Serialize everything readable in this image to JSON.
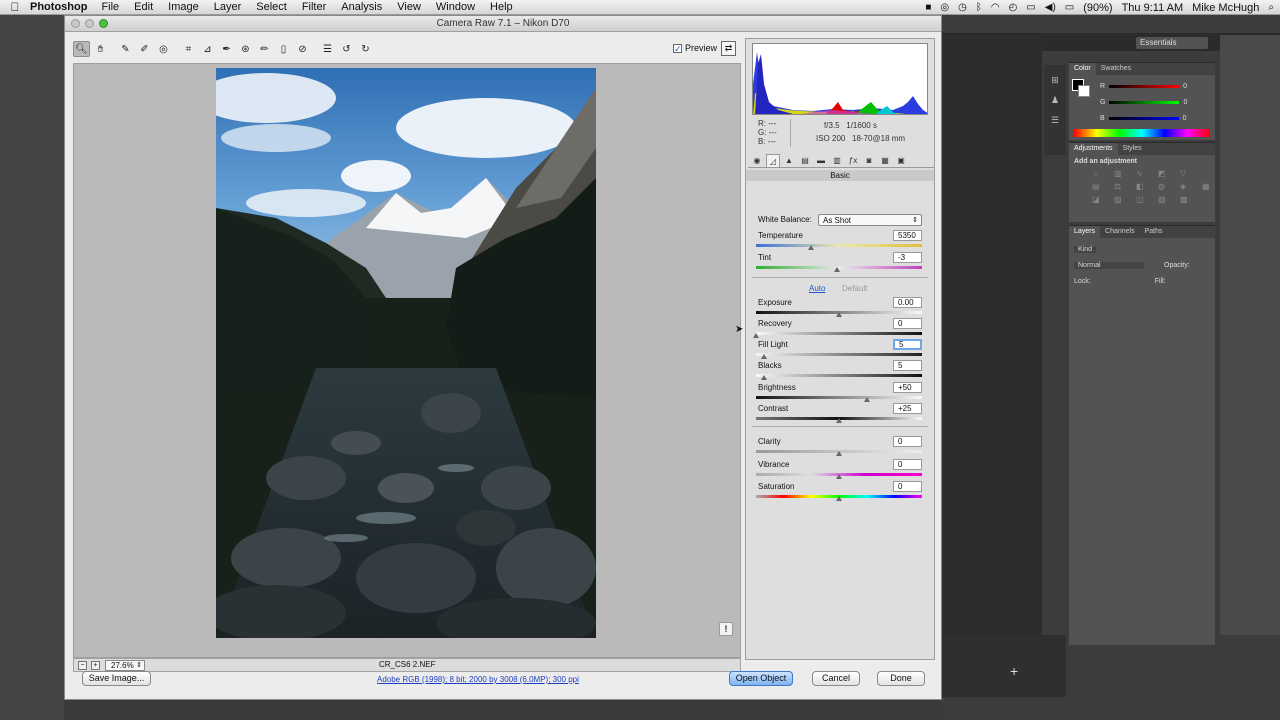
{
  "menubar": {
    "app_name": "Photoshop",
    "items": [
      "File",
      "Edit",
      "Image",
      "Layer",
      "Select",
      "Filter",
      "Analysis",
      "View",
      "Window",
      "Help"
    ],
    "battery": "(90%)",
    "clock": "Thu 9:11 AM",
    "user": "Mike McHugh"
  },
  "photoshop_bg": {
    "workspace": "Essentials",
    "color_panel": {
      "tabs": [
        "Color",
        "Swatches"
      ],
      "channels": [
        {
          "label": "R",
          "value": "0"
        },
        {
          "label": "G",
          "value": "0"
        },
        {
          "label": "B",
          "value": "0"
        }
      ]
    },
    "adjustments_panel": {
      "tabs": [
        "Adjustments",
        "Styles"
      ],
      "subtitle": "Add an adjustment"
    },
    "layers_panel": {
      "tabs": [
        "Layers",
        "Channels",
        "Paths"
      ],
      "kind": "Kind",
      "blend_mode": "Normal",
      "opacity_label": "Opacity:",
      "lock_label": "Lock:",
      "fill_label": "Fill:"
    }
  },
  "dialog": {
    "title": "Camera Raw 7.1  –  Nikon D70",
    "preview_label": "Preview",
    "zoom": "27.6%",
    "filename": "CR_CS6 2.NEF",
    "workflow_link": "Adobe RGB (1998); 8 bit; 2000 by 3008 (6.0MP); 300 ppi",
    "buttons": {
      "save": "Save Image...",
      "open": "Open Object",
      "cancel": "Cancel",
      "done": "Done"
    }
  },
  "info": {
    "r_label": "R:",
    "g_label": "G:",
    "b_label": "B:",
    "r_value": "---",
    "g_value": "---",
    "b_value": "---",
    "aperture": "f/3.5",
    "shutter": "1/1600 s",
    "iso": "ISO 200",
    "lens": "18-70@18 mm"
  },
  "basic": {
    "header": "Basic",
    "white_balance_label": "White Balance:",
    "white_balance_value": "As Shot",
    "auto_label": "Auto",
    "default_label": "Default",
    "controls": [
      {
        "label": "Temperature",
        "value": "5350",
        "level": 0.33
      },
      {
        "label": "Tint",
        "value": "-3",
        "level": 0.49
      },
      {
        "label": "Exposure",
        "value": "0.00",
        "level": 0.5
      },
      {
        "label": "Recovery",
        "value": "0",
        "level": 0.0
      },
      {
        "label": "Fill Light",
        "value": "5",
        "level": 0.05
      },
      {
        "label": "Blacks",
        "value": "5",
        "level": 0.05
      },
      {
        "label": "Brightness",
        "value": "+50",
        "level": 0.67
      },
      {
        "label": "Contrast",
        "value": "+25",
        "level": 0.5
      },
      {
        "label": "Clarity",
        "value": "0",
        "level": 0.5
      },
      {
        "label": "Vibrance",
        "value": "0",
        "level": 0.5
      },
      {
        "label": "Saturation",
        "value": "0",
        "level": 0.5
      }
    ]
  },
  "colors": {
    "accent": "#2058c8",
    "primary_button": "#7db3f1"
  }
}
